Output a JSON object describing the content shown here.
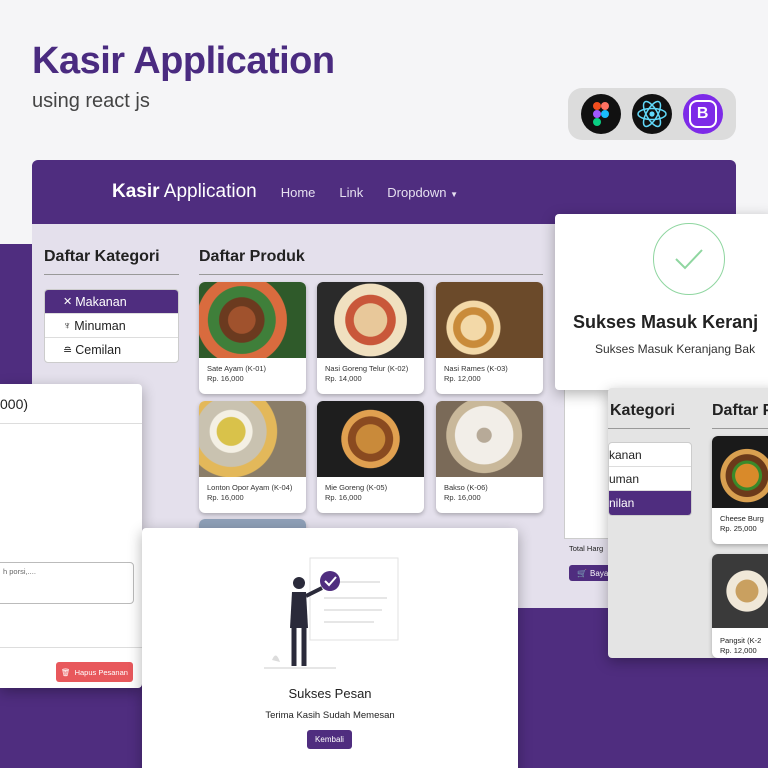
{
  "hero": {
    "title": "Kasir Application",
    "subtitle": "using react js"
  },
  "tech_icons": [
    "figma-icon",
    "react-icon",
    "bootstrap-icon"
  ],
  "colors": {
    "brand_purple": "#4f2d7f",
    "danger": "#e8585c",
    "success": "#8fd6a0"
  },
  "app": {
    "brand_bold": "Kasir",
    "brand_light": "Application",
    "nav": {
      "home": "Home",
      "link": "Link",
      "dropdown": "Dropdown"
    },
    "categories_title": "Daftar Kategori",
    "categories": [
      {
        "label": "Makanan",
        "icon": "utensils-icon",
        "active": true
      },
      {
        "label": "Minuman",
        "icon": "cup-icon",
        "active": false
      },
      {
        "label": "Cemilan",
        "icon": "snack-icon",
        "active": false
      }
    ],
    "products_title": "Daftar Produk",
    "products": [
      {
        "name": "Sate Ayam (K-01)",
        "price": "Rp. 16,000"
      },
      {
        "name": "Nasi Goreng Telur (K-02)",
        "price": "Rp. 14,000"
      },
      {
        "name": "Nasi Rames (K-03)",
        "price": "Rp. 12,000"
      },
      {
        "name": "Lonton Opor Ayam (K-04)",
        "price": "Rp. 16,000"
      },
      {
        "name": "Mie Goreng (K-05)",
        "price": "Rp. 16,000"
      },
      {
        "name": "Bakso (K-06)",
        "price": "Rp. 16,000"
      }
    ],
    "total_label": "Total Harg",
    "pay_button": "Bayar"
  },
  "modal_edit": {
    "title_fragment": "000)",
    "notes_placeholder": "h porsi,....",
    "delete_button": "Hapus Pesanan"
  },
  "modal_cart": {
    "title": "Sukses Masuk Keranj",
    "message": "Sukses Masuk Keranjang Bak"
  },
  "modal_pesan": {
    "title": "Sukses Pesan",
    "message": "Terima Kasih Sudah Memesan",
    "back_button": "Kembali"
  },
  "app_second": {
    "categories_title": "Kategori",
    "products_title": "Daftar P",
    "categories": [
      {
        "label": "kanan",
        "active": false
      },
      {
        "label": "uman",
        "active": false
      },
      {
        "label": "nilan",
        "active": true
      }
    ],
    "products": [
      {
        "name": "Cheese Burg",
        "price": "Rp. 25,000"
      },
      {
        "name": "Pangsit (K-2",
        "price": "Rp. 12,000"
      }
    ]
  }
}
